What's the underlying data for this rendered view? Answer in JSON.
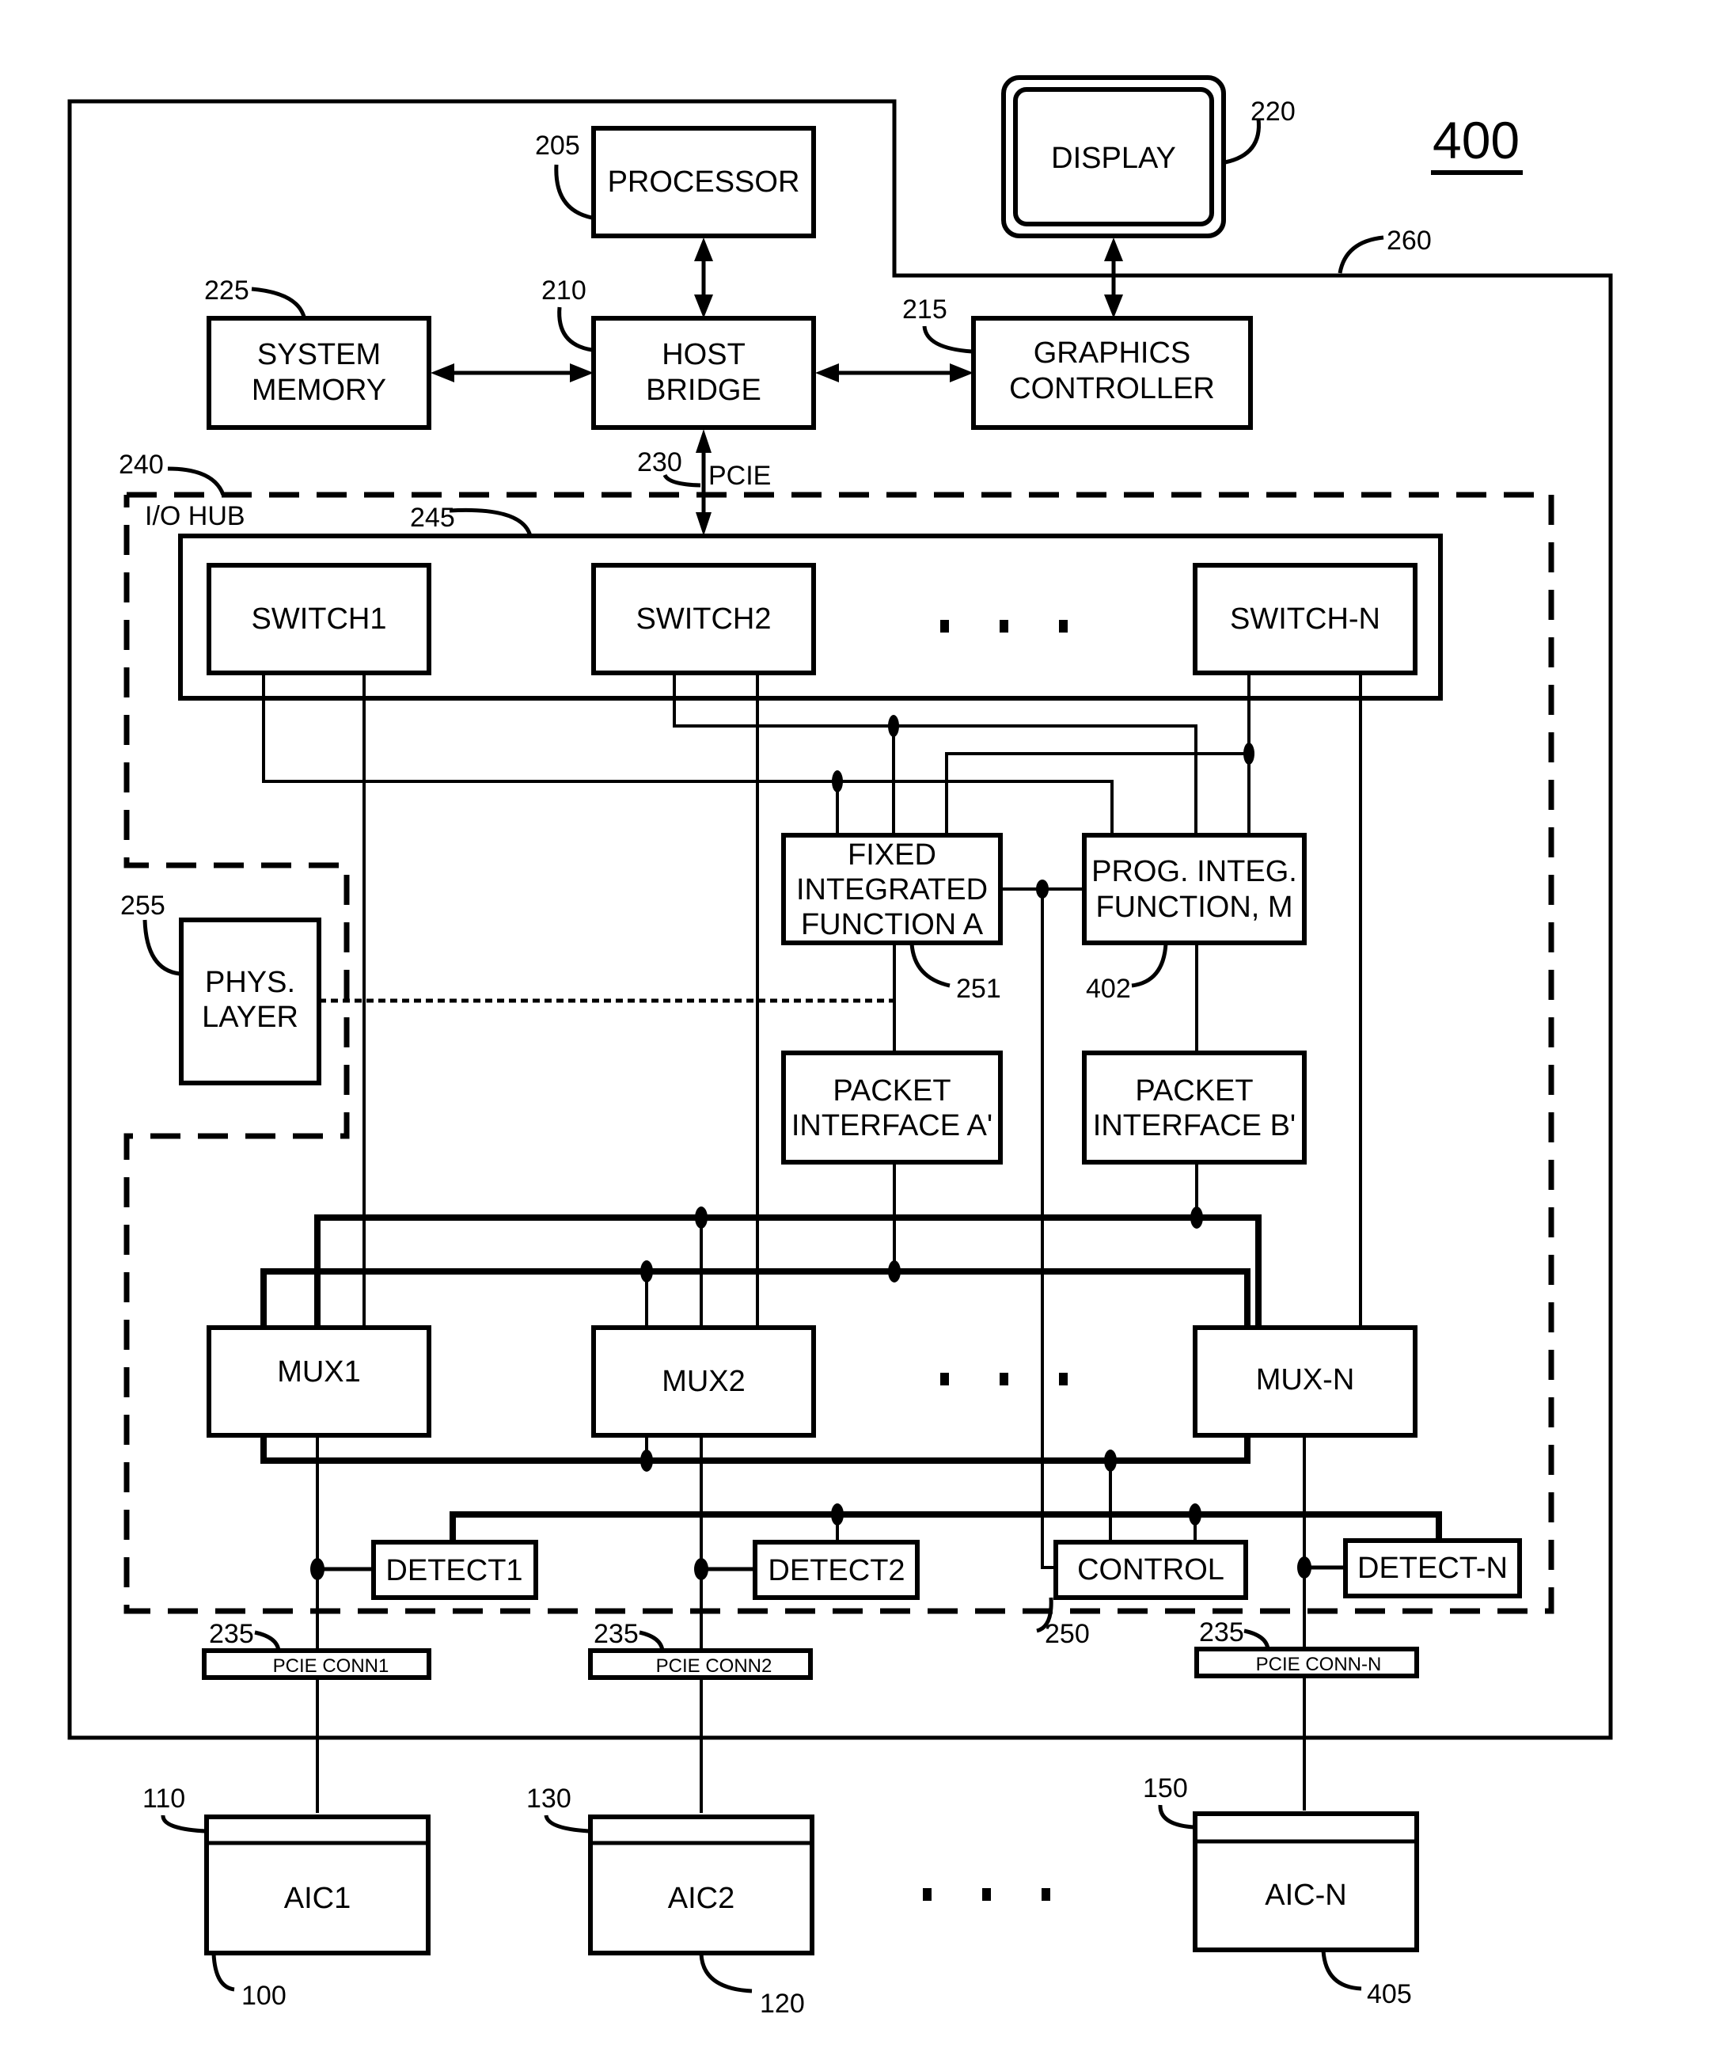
{
  "figure": {
    "number": "400",
    "system_ref": "260"
  },
  "blocks": {
    "processor": {
      "label": "PROCESSOR",
      "ref": "205"
    },
    "display": {
      "label": "DISPLAY",
      "ref": "220"
    },
    "host_bridge": {
      "line1": "HOST",
      "line2": "BRIDGE",
      "ref": "210"
    },
    "system_memory": {
      "line1": "SYSTEM",
      "line2": "MEMORY",
      "ref": "225"
    },
    "graphics_controller": {
      "line1": "GRAPHICS",
      "line2": "CONTROLLER",
      "ref": "215"
    },
    "pcie_link": {
      "label": "PCIE",
      "ref": "230"
    },
    "io_hub": {
      "label": "I/O HUB",
      "ref": "240"
    },
    "switch_fabric": {
      "ref": "245"
    },
    "switches": [
      {
        "label": "SWITCH1"
      },
      {
        "label": "SWITCH2"
      },
      {
        "label": "SWITCH-N"
      }
    ],
    "fixed_function": {
      "line1": "FIXED",
      "line2": "INTEGRATED",
      "line3": "FUNCTION A",
      "ref": "251"
    },
    "prog_function": {
      "line1": "PROG. INTEG.",
      "line2": "FUNCTION, M",
      "ref": "402"
    },
    "phys_layer": {
      "line1": "PHYS.",
      "line2": "LAYER",
      "ref": "255"
    },
    "packet_a": {
      "line1": "PACKET",
      "line2": "INTERFACE A'"
    },
    "packet_b": {
      "line1": "PACKET",
      "line2": "INTERFACE B'"
    },
    "muxes": [
      {
        "label": "MUX1"
      },
      {
        "label": "MUX2"
      },
      {
        "label": "MUX-N"
      }
    ],
    "detects": [
      {
        "label": "DETECT1"
      },
      {
        "label": "DETECT2"
      },
      {
        "label": "DETECT-N"
      }
    ],
    "control": {
      "label": "CONTROL",
      "ref": "250"
    },
    "connectors": [
      {
        "label": "PCIE CONN1",
        "ref": "235"
      },
      {
        "label": "PCIE CONN2",
        "ref": "235"
      },
      {
        "label": "PCIE CONN-N",
        "ref": "235"
      }
    ],
    "aics": [
      {
        "label": "AIC1",
        "card_ref": "100",
        "edge_ref": "110"
      },
      {
        "label": "AIC2",
        "card_ref": "120",
        "edge_ref": "130"
      },
      {
        "label": "AIC-N",
        "card_ref": "405",
        "edge_ref": "150"
      }
    ]
  }
}
